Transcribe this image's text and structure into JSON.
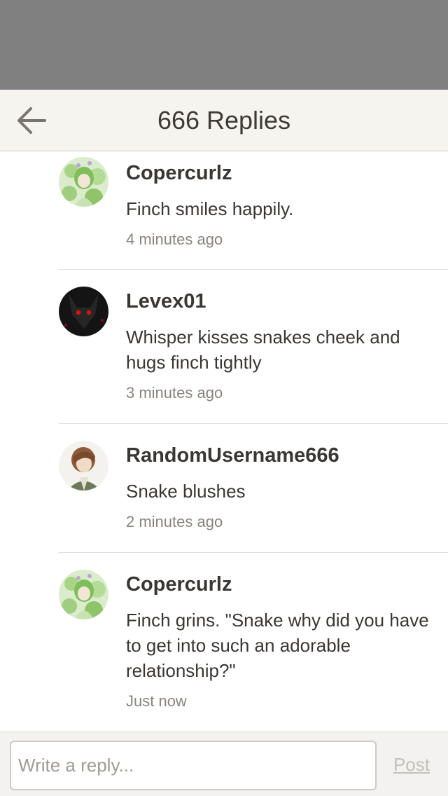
{
  "header": {
    "title": "666 Replies",
    "back_icon": "arrow-left-icon"
  },
  "replies": [
    {
      "username": "Copercurlz",
      "message": "Finch smiles happily.",
      "time": "4 minutes ago",
      "avatar": "green-hair-character-avatar"
    },
    {
      "username": "Levex01",
      "message": "Whisper kisses snakes cheek and hugs finch tightly",
      "time": "3 minutes ago",
      "avatar": "dark-wolf-red-eyes-avatar"
    },
    {
      "username": "RandomUsername666",
      "message": "Snake blushes",
      "time": "2 minutes ago",
      "avatar": "brown-hair-character-avatar"
    },
    {
      "username": "Copercurlz",
      "message": "Finch grins. \"Snake why did you have to get into such an adorable relationship?\"",
      "time": "Just now",
      "avatar": "green-hair-character-avatar"
    }
  ],
  "compose": {
    "placeholder": "Write a reply...",
    "value": "",
    "post_label": "Post"
  },
  "colors": {
    "status_area": "#808080",
    "header_bg": "#f6f4ee",
    "text": "#3a3633",
    "muted": "#8a8480",
    "post_disabled": "#c5c0ba"
  }
}
